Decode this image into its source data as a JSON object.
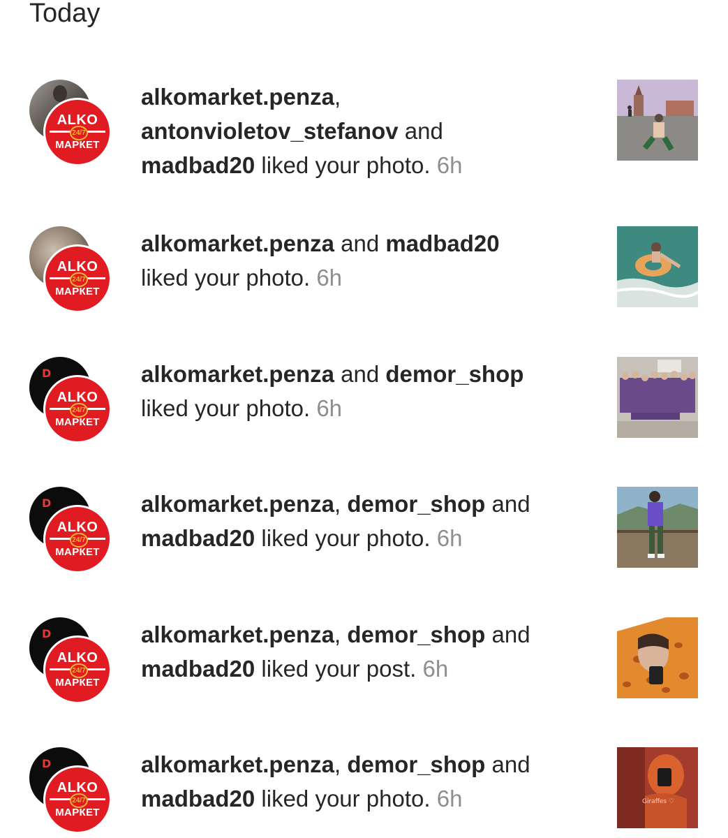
{
  "section": {
    "title": "Today"
  },
  "notifications": [
    {
      "actors": [
        "alkomarket.penza",
        "antonvioletov_stefanov",
        "madbad20"
      ],
      "joiner1": ",",
      "joiner2": "and",
      "action": "liked your photo.",
      "time": "6h",
      "back_avatar": "gray-avatar-man",
      "front_avatar": {
        "top": "ALKO",
        "badge": "24/7",
        "bottom": "МАРКЕТ"
      },
      "thumbnail": "photo-red-square-moscow"
    },
    {
      "actors": [
        "alkomarket.penza",
        "madbad20"
      ],
      "joiner1": "and",
      "action": "liked your photo.",
      "time": "6h",
      "back_avatar": "gray-avatar-blurred",
      "front_avatar": {
        "top": "ALKO",
        "badge": "24/7",
        "bottom": "МАРКЕТ"
      },
      "thumbnail": "photo-sea-donut-float"
    },
    {
      "actors": [
        "alkomarket.penza",
        "demor_shop"
      ],
      "joiner1": "and",
      "action": "liked your photo.",
      "time": "6h",
      "back_avatar": "demor-shop-logo",
      "front_avatar": {
        "top": "ALKO",
        "badge": "24/7",
        "bottom": "МАРКЕТ"
      },
      "thumbnail": "photo-group-purple-shirts"
    },
    {
      "actors": [
        "alkomarket.penza",
        "demor_shop",
        "madbad20"
      ],
      "joiner1": ",",
      "joiner2": "and",
      "action": "liked your photo.",
      "time": "6h",
      "back_avatar": "demor-shop-logo",
      "front_avatar": {
        "top": "ALKO",
        "badge": "24/7",
        "bottom": "МАРКЕТ"
      },
      "thumbnail": "photo-mountain-view-girl"
    },
    {
      "actors": [
        "alkomarket.penza",
        "demor_shop",
        "madbad20"
      ],
      "joiner1": ",",
      "joiner2": "and",
      "action": "liked your post.",
      "time": "6h",
      "back_avatar": "demor-shop-logo",
      "front_avatar": {
        "top": "ALKO",
        "badge": "24/7",
        "bottom": "МАРКЕТ"
      },
      "thumbnail": "photo-giraffe-onesie-selfie"
    },
    {
      "actors": [
        "alkomarket.penza",
        "demor_shop",
        "madbad20"
      ],
      "joiner1": ",",
      "joiner2": "and",
      "action": "liked your photo.",
      "time": "6h",
      "back_avatar": "demor-shop-logo",
      "front_avatar": {
        "top": "ALKO",
        "badge": "24/7",
        "bottom": "МАРКЕТ"
      },
      "thumbnail": "photo-orange-onesie-mirror",
      "thumbnail_caption": "Giraffes ♡"
    }
  ]
}
